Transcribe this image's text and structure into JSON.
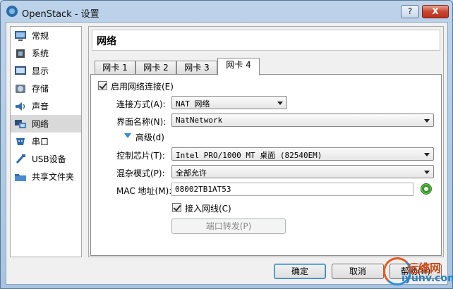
{
  "window": {
    "title": "OpenStack - 设置",
    "help_button": "?",
    "close_button": "X"
  },
  "sidebar": {
    "items": [
      {
        "label": "常规",
        "icon": "monitor-icon"
      },
      {
        "label": "系统",
        "icon": "chip-icon"
      },
      {
        "label": "显示",
        "icon": "display-icon"
      },
      {
        "label": "存储",
        "icon": "disk-icon"
      },
      {
        "label": "声音",
        "icon": "speaker-icon"
      },
      {
        "label": "网络",
        "icon": "network-icon",
        "selected": true
      },
      {
        "label": "串口",
        "icon": "serial-port-icon"
      },
      {
        "label": "USB设备",
        "icon": "usb-icon"
      },
      {
        "label": "共享文件夹",
        "icon": "folder-icon"
      }
    ]
  },
  "panel": {
    "title": "网络",
    "tabs": [
      {
        "label": "网卡 1"
      },
      {
        "label": "网卡 2"
      },
      {
        "label": "网卡 3"
      },
      {
        "label": "网卡 4",
        "active": true
      }
    ],
    "adapter": {
      "enable_label": "启用网络连接(E)",
      "enable_checked": true,
      "attached_label": "连接方式(A):",
      "attached_value": "NAT 网络",
      "name_label": "界面名称(N):",
      "name_value": "NatNetwork",
      "advanced_label": "高级(d)",
      "adapter_type_label": "控制芯片(T):",
      "adapter_type_value": "Intel PRO/1000 MT 桌面 (82540EM)",
      "promisc_label": "混杂模式(P):",
      "promisc_value": "全部允许",
      "mac_label": "MAC 地址(M):",
      "mac_value": "08002TB1AT53",
      "cable_label": "接入网线(C)",
      "cable_checked": true,
      "port_forward_label": "端口转发(P)"
    }
  },
  "footer": {
    "ok": "确定",
    "cancel": "取消",
    "help": "帮助(H)"
  },
  "watermark": {
    "line1": "运维网",
    "line2": "iyunv.com"
  }
}
